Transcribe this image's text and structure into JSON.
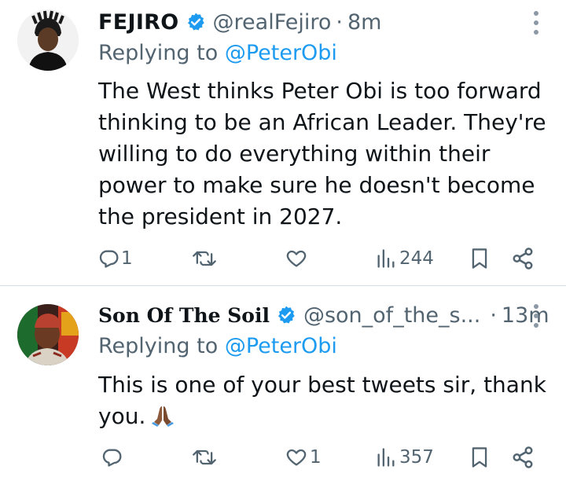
{
  "tweets": [
    {
      "display_name": "FEJIRO",
      "handle": "@realFejiro",
      "separator": "·",
      "time": "8m",
      "replying_prefix": "Replying to ",
      "replying_to": "@PeterObi",
      "text": "The West thinks Peter Obi is too forward thinking to be an African Leader. They're willing to do everything within their power to make sure he doesn't become the president in 2027.",
      "replies": "1",
      "retweets": "",
      "likes": "",
      "views": "244"
    },
    {
      "display_name": "Son Of The Soil",
      "handle": "@son_of_the_s...",
      "separator": "·",
      "time": "13m",
      "replying_prefix": "Replying to ",
      "replying_to": "@PeterObi",
      "text": "This is one of your best tweets sir, thank you.",
      "emoji": "folded-hands",
      "replies": "",
      "retweets": "",
      "likes": "1",
      "views": "357"
    }
  ],
  "colors": {
    "text": "#0f1419",
    "secondary": "#536471",
    "accent": "#1d9bf0",
    "divider": "#d6dbe0"
  },
  "icons": [
    "reply-icon",
    "retweet-icon",
    "like-icon",
    "views-icon",
    "bookmark-icon",
    "share-icon",
    "verified-badge-icon",
    "more-icon"
  ]
}
